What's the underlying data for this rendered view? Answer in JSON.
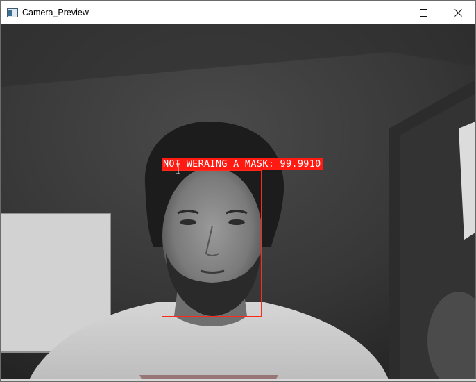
{
  "window": {
    "title": "Camera_Preview",
    "controls": {
      "minimize_icon": "minimize-icon",
      "maximize_icon": "maximize-icon",
      "close_icon": "close-icon"
    }
  },
  "detection": {
    "label": "NOT WERAING A MASK: 99.9910",
    "box_color": "#ff2a1a",
    "label_bg": "#ff1a12"
  }
}
